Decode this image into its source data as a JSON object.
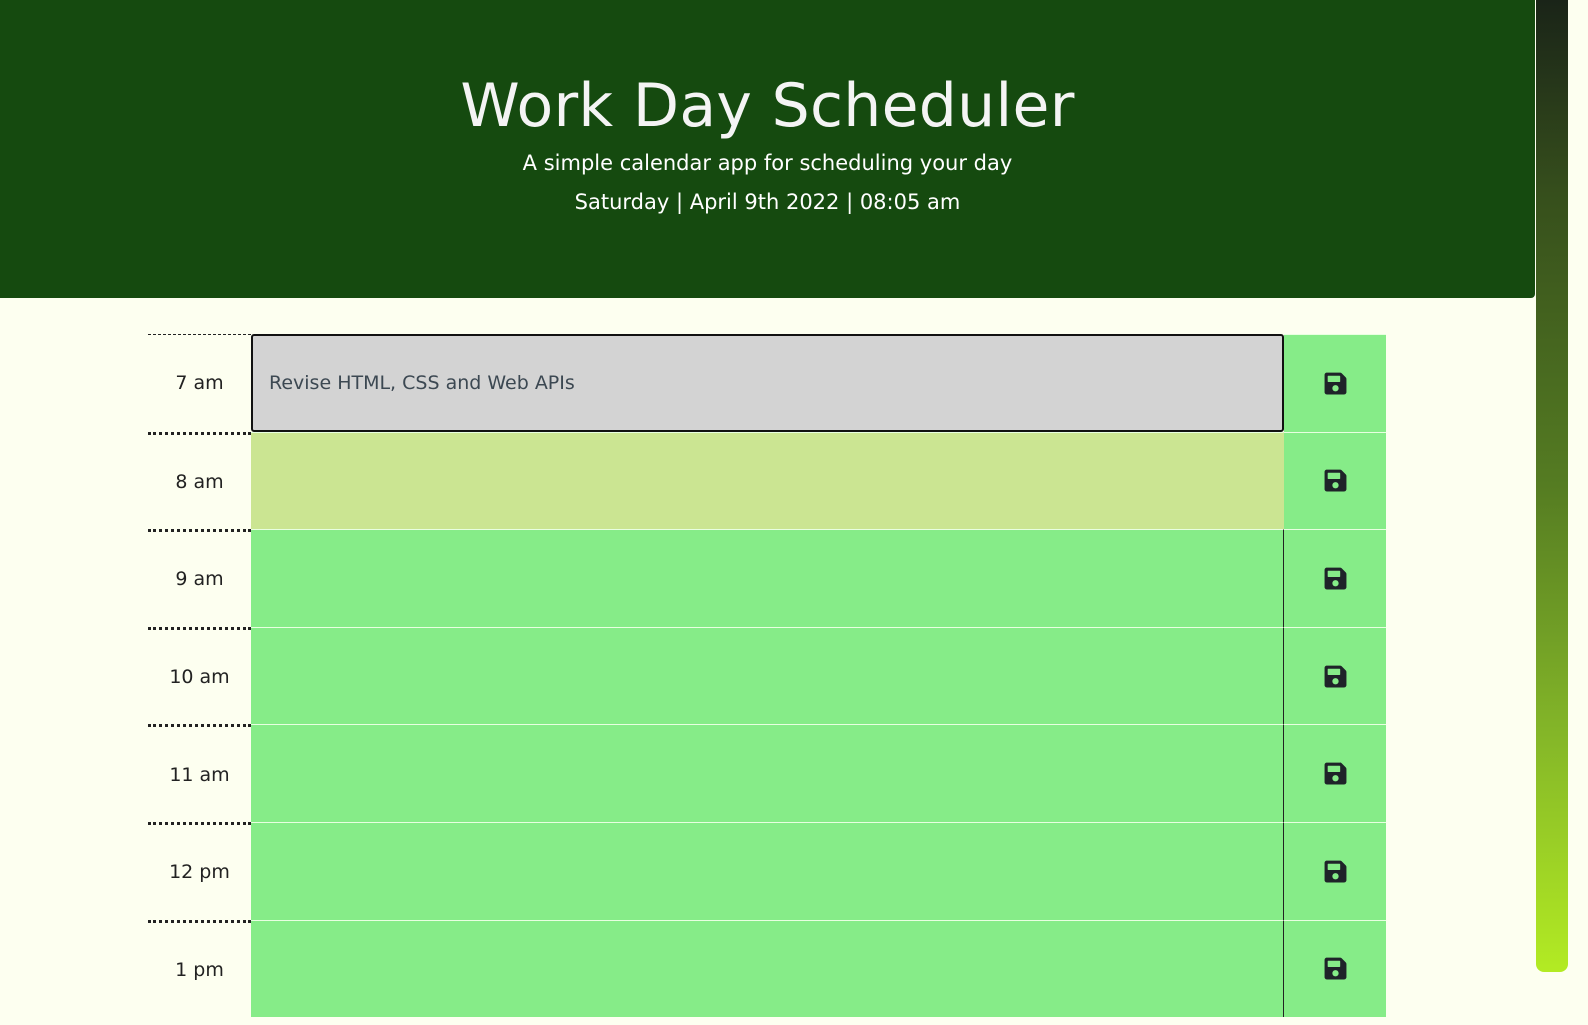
{
  "header": {
    "title": "Work Day Scheduler",
    "subtitle": "A simple calendar app for scheduling your day",
    "datetime": "Saturday | April 9th 2022 | 08:05 am"
  },
  "colors": {
    "header_bg": "#154a0f",
    "page_bg": "#fdfff0",
    "past": "#d3d3d3",
    "present": "#cbe592",
    "future": "#86ec88"
  },
  "schedule": {
    "rows": [
      {
        "hour": "7 am",
        "task": "Revise HTML, CSS and Web APIs",
        "state": "past",
        "save_icon": "floppy-disk-icon"
      },
      {
        "hour": "8 am",
        "task": "",
        "state": "present",
        "save_icon": "floppy-disk-icon"
      },
      {
        "hour": "9 am",
        "task": "",
        "state": "future",
        "save_icon": "floppy-disk-icon"
      },
      {
        "hour": "10 am",
        "task": "",
        "state": "future",
        "save_icon": "floppy-disk-icon"
      },
      {
        "hour": "11 am",
        "task": "",
        "state": "future",
        "save_icon": "floppy-disk-icon"
      },
      {
        "hour": "12 pm",
        "task": "",
        "state": "future",
        "save_icon": "floppy-disk-icon"
      },
      {
        "hour": "1 pm",
        "task": "",
        "state": "future",
        "save_icon": "floppy-disk-icon"
      }
    ]
  }
}
